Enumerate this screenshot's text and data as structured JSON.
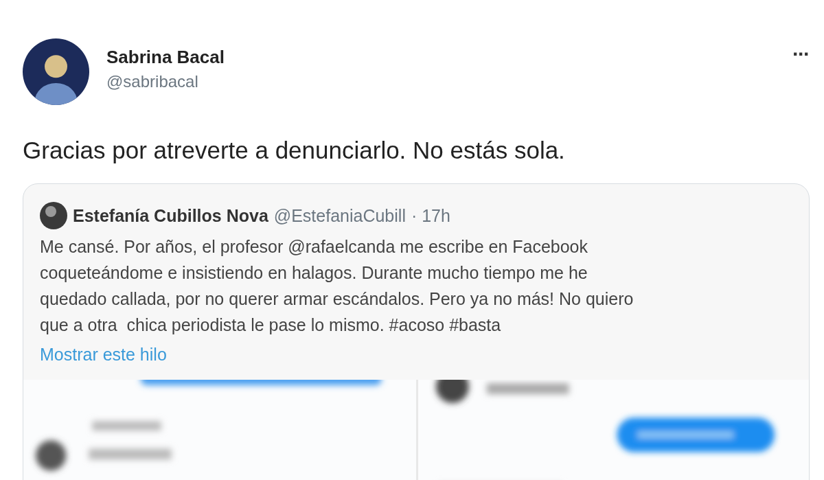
{
  "tweet": {
    "author": {
      "name": "Sabrina Bacal",
      "handle": "@sabribacal"
    },
    "menu": "···",
    "text": "Gracias por atreverte a denunciarlo. No estás sola.",
    "quoted": {
      "author": {
        "name": "Estefanía Cubillos Nova",
        "handle": "@EstefaniaCubill",
        "time": "· 17h"
      },
      "lines": [
        "Me cansé. Por años, el profesor @rafaelcanda me escribe en Facebook",
        "coqueteándome e insistiendo en halagos. Durante mucho tiempo me he",
        "quedado callada, por no querer armar escándalos. Pero ya no más! No quiero",
        "que a otra  chica periodista le pase lo mismo. #acoso #basta"
      ],
      "link": "Mostrar este hilo"
    }
  }
}
